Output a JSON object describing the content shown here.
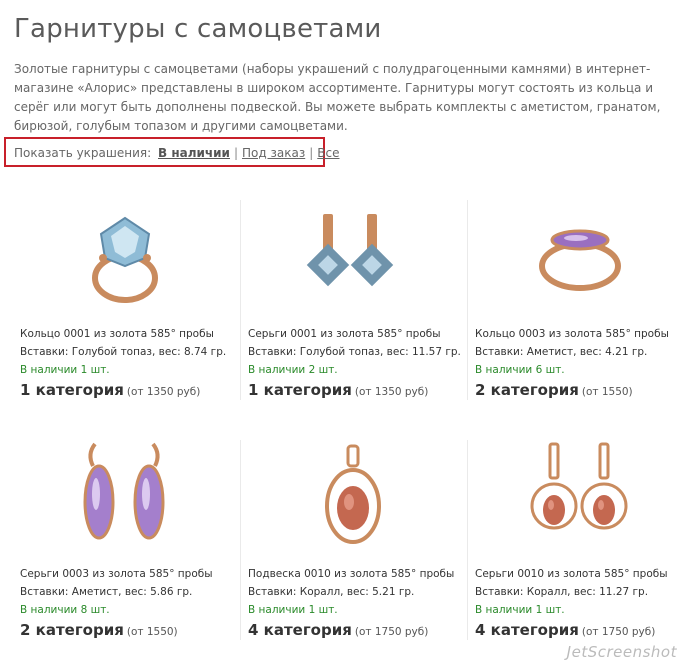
{
  "page": {
    "title": "Гарнитуры с самоцветами",
    "intro": "Золотые гарнитуры с самоцветами (наборы украшений с полудрагоценными камнями) в интернет-магазине «Алорис» представлены в широком ассортименте. Гарнитуры могут состоять из кольца и серёг или могут быть дополнены подвеской. Вы можете выбрать комплекты с аметистом, гранатом, бирюзой, голубым топазом и другими самоцветами."
  },
  "filter": {
    "label": "Показать украшения:",
    "in_stock": "В наличии",
    "sep1": "|",
    "on_order": "Под заказ",
    "sep2": "|",
    "all": "Все"
  },
  "products": [
    {
      "title": "Кольцо 0001 из золота 585° пробы",
      "inserts": "Вставки: Голубой топаз, вес: 8.74 гр.",
      "stock": "В наличии 1 шт.",
      "category": "1 категория",
      "price": "(от 1350 руб)",
      "image": "ring-blue-topaz"
    },
    {
      "title": "Серьги 0001 из золота 585° пробы",
      "inserts": "Вставки: Голубой топаз, вес: 11.57 гр.",
      "stock": "В наличии 2 шт.",
      "category": "1 категория",
      "price": "(от 1350 руб)",
      "image": "earrings-blue-topaz"
    },
    {
      "title": "Кольцо 0003 из золота 585° пробы",
      "inserts": "Вставки: Аметист, вес: 4.21 гр.",
      "stock": "В наличии 6 шт.",
      "category": "2 категория",
      "price": "(от 1550)",
      "image": "ring-amethyst"
    },
    {
      "title": "Серьги 0003 из золота 585° пробы",
      "inserts": "Вставки: Аметист, вес: 5.86 гр.",
      "stock": "В наличии 8 шт.",
      "category": "2 категория",
      "price": "(от 1550)",
      "image": "earrings-amethyst"
    },
    {
      "title": "Подвеска 0010 из золота 585° пробы",
      "inserts": "Вставки: Коралл, вес: 5.21 гр.",
      "stock": "В наличии 1 шт.",
      "category": "4 категория",
      "price": "(от 1750 руб)",
      "image": "pendant-coral"
    },
    {
      "title": "Серьги 0010 из золота 585° пробы",
      "inserts": "Вставки: Коралл, вес: 11.27 гр.",
      "stock": "В наличии 1 шт.",
      "category": "4 категория",
      "price": "(от 1750 руб)",
      "image": "earrings-coral"
    }
  ],
  "colors": {
    "gold": "#c98b5e",
    "blue_topaz": "#7fa8c4",
    "amethyst": "#9a6fc0",
    "coral": "#c46850",
    "stock_green": "#2a8a2a",
    "highlight_red": "#c8202a"
  },
  "watermark": "JetScreenshot"
}
